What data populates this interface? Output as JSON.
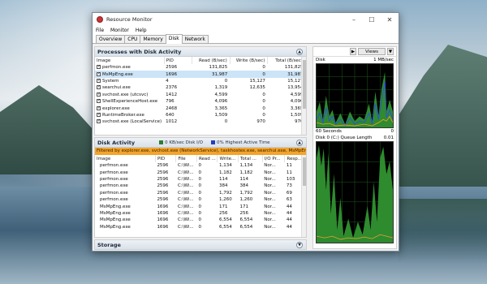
{
  "window": {
    "title": "Resource Monitor"
  },
  "menu": [
    "File",
    "Monitor",
    "Help"
  ],
  "tabs": [
    "Overview",
    "CPU",
    "Memory",
    "Disk",
    "Network"
  ],
  "processes": {
    "title": "Processes with Disk Activity",
    "columns": [
      "Image",
      "PID",
      "Read (B/sec)",
      "Write (B/sec)",
      "Total (B/sec)"
    ],
    "rows": [
      [
        "perfmon.exe",
        "2596",
        "131,825",
        "0",
        "131,825"
      ],
      [
        "MsMpEng.exe",
        "1696",
        "31,987",
        "0",
        "31,987"
      ],
      [
        "System",
        "4",
        "0",
        "15,127",
        "15,127"
      ],
      [
        "searchui.exe",
        "2376",
        "1,319",
        "12,635",
        "13,954"
      ],
      [
        "svchost.exe (utcsvc)",
        "1412",
        "4,599",
        "0",
        "4,599"
      ],
      [
        "ShellExperienceHost.exe",
        "796",
        "4,096",
        "0",
        "4,096"
      ],
      [
        "explorer.exe",
        "2468",
        "3,365",
        "0",
        "3,365"
      ],
      [
        "RuntimeBroker.exe",
        "640",
        "1,509",
        "0",
        "1,509"
      ],
      [
        "svchost.exe (LocalService)",
        "1012",
        "0",
        "970",
        "970"
      ]
    ]
  },
  "disk": {
    "title": "Disk Activity",
    "io_legend": "0 KB/sec Disk I/O",
    "active_legend": "0% Highest Active Time",
    "io_color": "#2e7d32",
    "active_color": "#1f3fbf",
    "filter": "Filtered by explorer.exe, svchost.exe (NetworkService), taskhostex.exe, searchui.exe, MsMpEng.exe, s...",
    "columns": [
      "Image",
      "PID",
      "File",
      "Read ...",
      "Write...",
      "Total ...",
      "I/O Pr...",
      "Resp..."
    ],
    "rows": [
      [
        "perfmon.exe",
        "2596",
        "C:\\Wi...",
        "0",
        "1,134",
        "1,134",
        "Nor...",
        "11"
      ],
      [
        "perfmon.exe",
        "2596",
        "C:\\Wi...",
        "0",
        "1,182",
        "1,182",
        "Nor...",
        "11"
      ],
      [
        "perfmon.exe",
        "2596",
        "C:\\Wi...",
        "0",
        "114",
        "114",
        "Nor...",
        "103"
      ],
      [
        "perfmon.exe",
        "2596",
        "C:\\Wi...",
        "0",
        "384",
        "384",
        "Nor...",
        "73"
      ],
      [
        "perfmon.exe",
        "2596",
        "C:\\Wi...",
        "0",
        "1,792",
        "1,792",
        "Nor...",
        "69"
      ],
      [
        "perfmon.exe",
        "2596",
        "C:\\Wi...",
        "0",
        "1,260",
        "1,260",
        "Nor...",
        "63"
      ],
      [
        "MsMpEng.exe",
        "1696",
        "C:\\Wi...",
        "0",
        "171",
        "171",
        "Nor...",
        "44"
      ],
      [
        "MsMpEng.exe",
        "1696",
        "C:\\Wi...",
        "0",
        "256",
        "256",
        "Nor...",
        "44"
      ],
      [
        "MsMpEng.exe",
        "1696",
        "C:\\Wi...",
        "0",
        "6,554",
        "6,554",
        "Nor...",
        "44"
      ],
      [
        "MsMpEng.exe",
        "1696",
        "C:\\Wi...",
        "0",
        "6,554",
        "6,554",
        "Nor...",
        "44"
      ]
    ]
  },
  "storage": {
    "title": "Storage"
  },
  "right": {
    "views_label": "Views",
    "disk_label": "Disk",
    "disk_scale": "1 MB/sec",
    "time_label": "60 Seconds",
    "time_value": "0",
    "queue_label": "Disk 0 (C:) Queue Length",
    "queue_scale": "0.01"
  }
}
